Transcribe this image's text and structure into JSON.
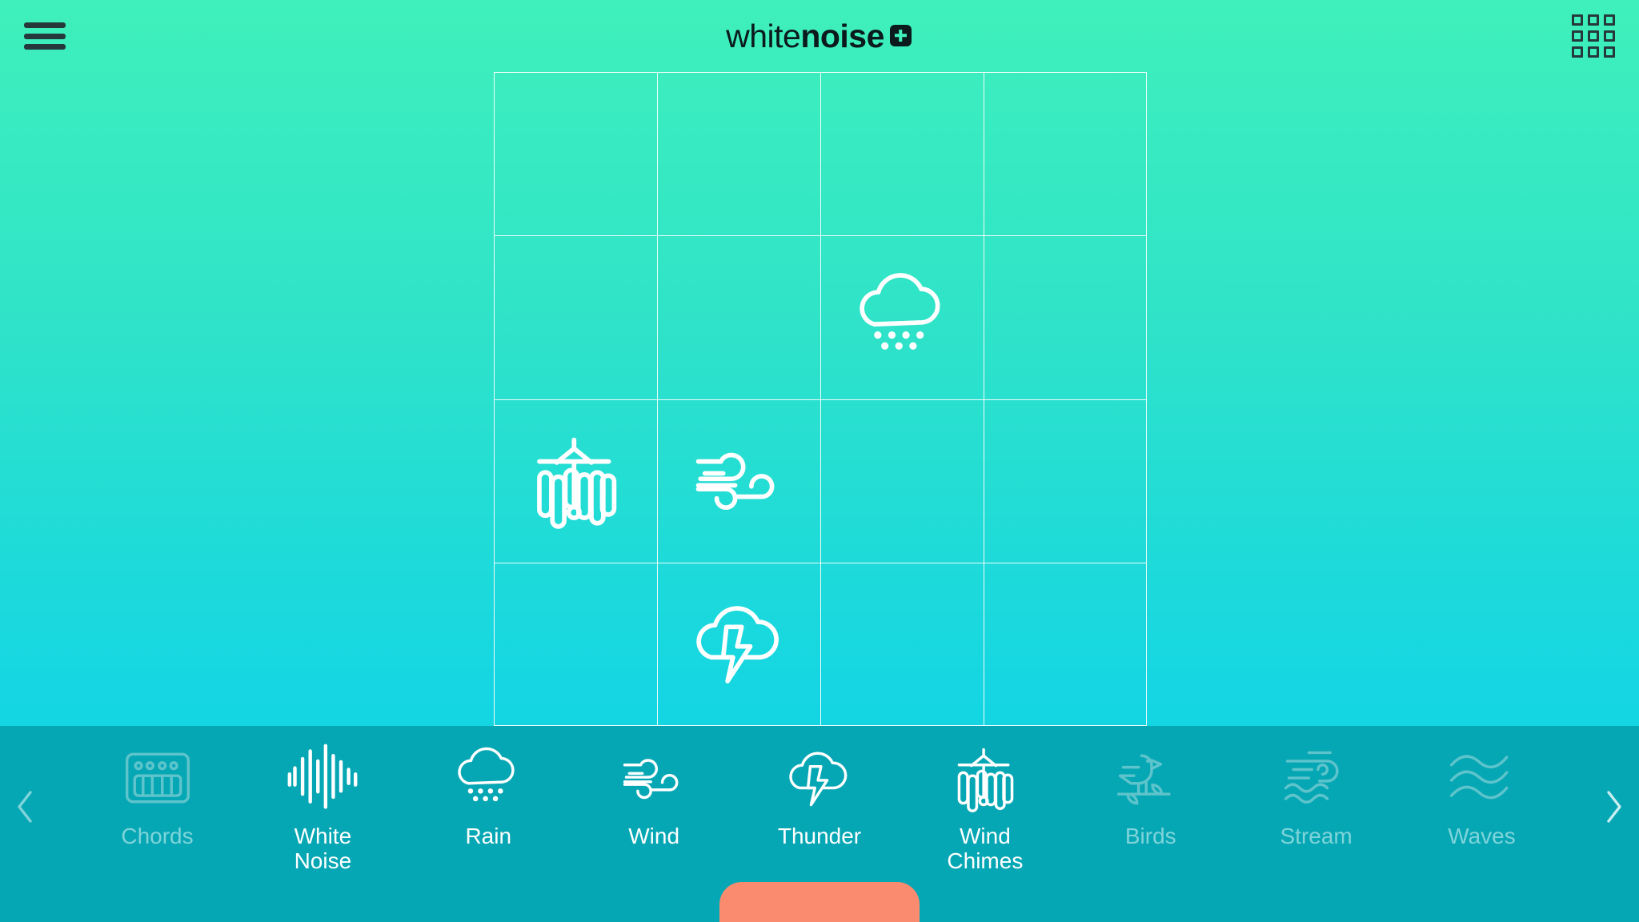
{
  "app": {
    "name_light": "white",
    "name_bold": "noise",
    "plus_badge": "plus-badge"
  },
  "header": {
    "menu_icon": "hamburger-menu-icon",
    "grid_icon": "grid-view-icon"
  },
  "mixer": {
    "rows": 4,
    "columns": 4,
    "cells": [
      {
        "row": 1,
        "col": 1,
        "icon": ""
      },
      {
        "row": 1,
        "col": 2,
        "icon": ""
      },
      {
        "row": 1,
        "col": 3,
        "icon": ""
      },
      {
        "row": 1,
        "col": 4,
        "icon": ""
      },
      {
        "row": 2,
        "col": 1,
        "icon": ""
      },
      {
        "row": 2,
        "col": 2,
        "icon": ""
      },
      {
        "row": 2,
        "col": 3,
        "icon": "rain"
      },
      {
        "row": 2,
        "col": 4,
        "icon": ""
      },
      {
        "row": 3,
        "col": 1,
        "icon": "wind-chimes"
      },
      {
        "row": 3,
        "col": 2,
        "icon": "wind"
      },
      {
        "row": 3,
        "col": 3,
        "icon": ""
      },
      {
        "row": 3,
        "col": 4,
        "icon": ""
      },
      {
        "row": 4,
        "col": 1,
        "icon": ""
      },
      {
        "row": 4,
        "col": 2,
        "icon": "thunder"
      },
      {
        "row": 4,
        "col": 3,
        "icon": ""
      },
      {
        "row": 4,
        "col": 4,
        "icon": ""
      }
    ]
  },
  "toolbar": {
    "prev_icon": "chevron-left-icon",
    "next_icon": "chevron-right-icon",
    "sounds": [
      {
        "label": "Chords",
        "icon": "chords",
        "active": false
      },
      {
        "label": "White\nNoise",
        "icon": "white-noise",
        "active": true
      },
      {
        "label": "Rain",
        "icon": "rain",
        "active": true
      },
      {
        "label": "Wind",
        "icon": "wind",
        "active": true
      },
      {
        "label": "Thunder",
        "icon": "thunder",
        "active": true
      },
      {
        "label": "Wind\nChimes",
        "icon": "wind-chimes",
        "active": true
      },
      {
        "label": "Birds",
        "icon": "birds",
        "active": false
      },
      {
        "label": "Stream",
        "icon": "stream",
        "active": false
      },
      {
        "label": "Waves",
        "icon": "waves",
        "active": false
      }
    ]
  },
  "bottom_handle": {
    "name": "drawer-handle",
    "color": "#fb8b6e"
  },
  "colors": {
    "bg_top": "#3ff0bb",
    "bg_bottom": "#0dcfe0",
    "toolbar": "#06a7b4",
    "accent": "#fb8b6e",
    "active_text": "#ffffff",
    "inactive_text": "#7fd4da",
    "logo_dark": "#0b1b1d"
  }
}
